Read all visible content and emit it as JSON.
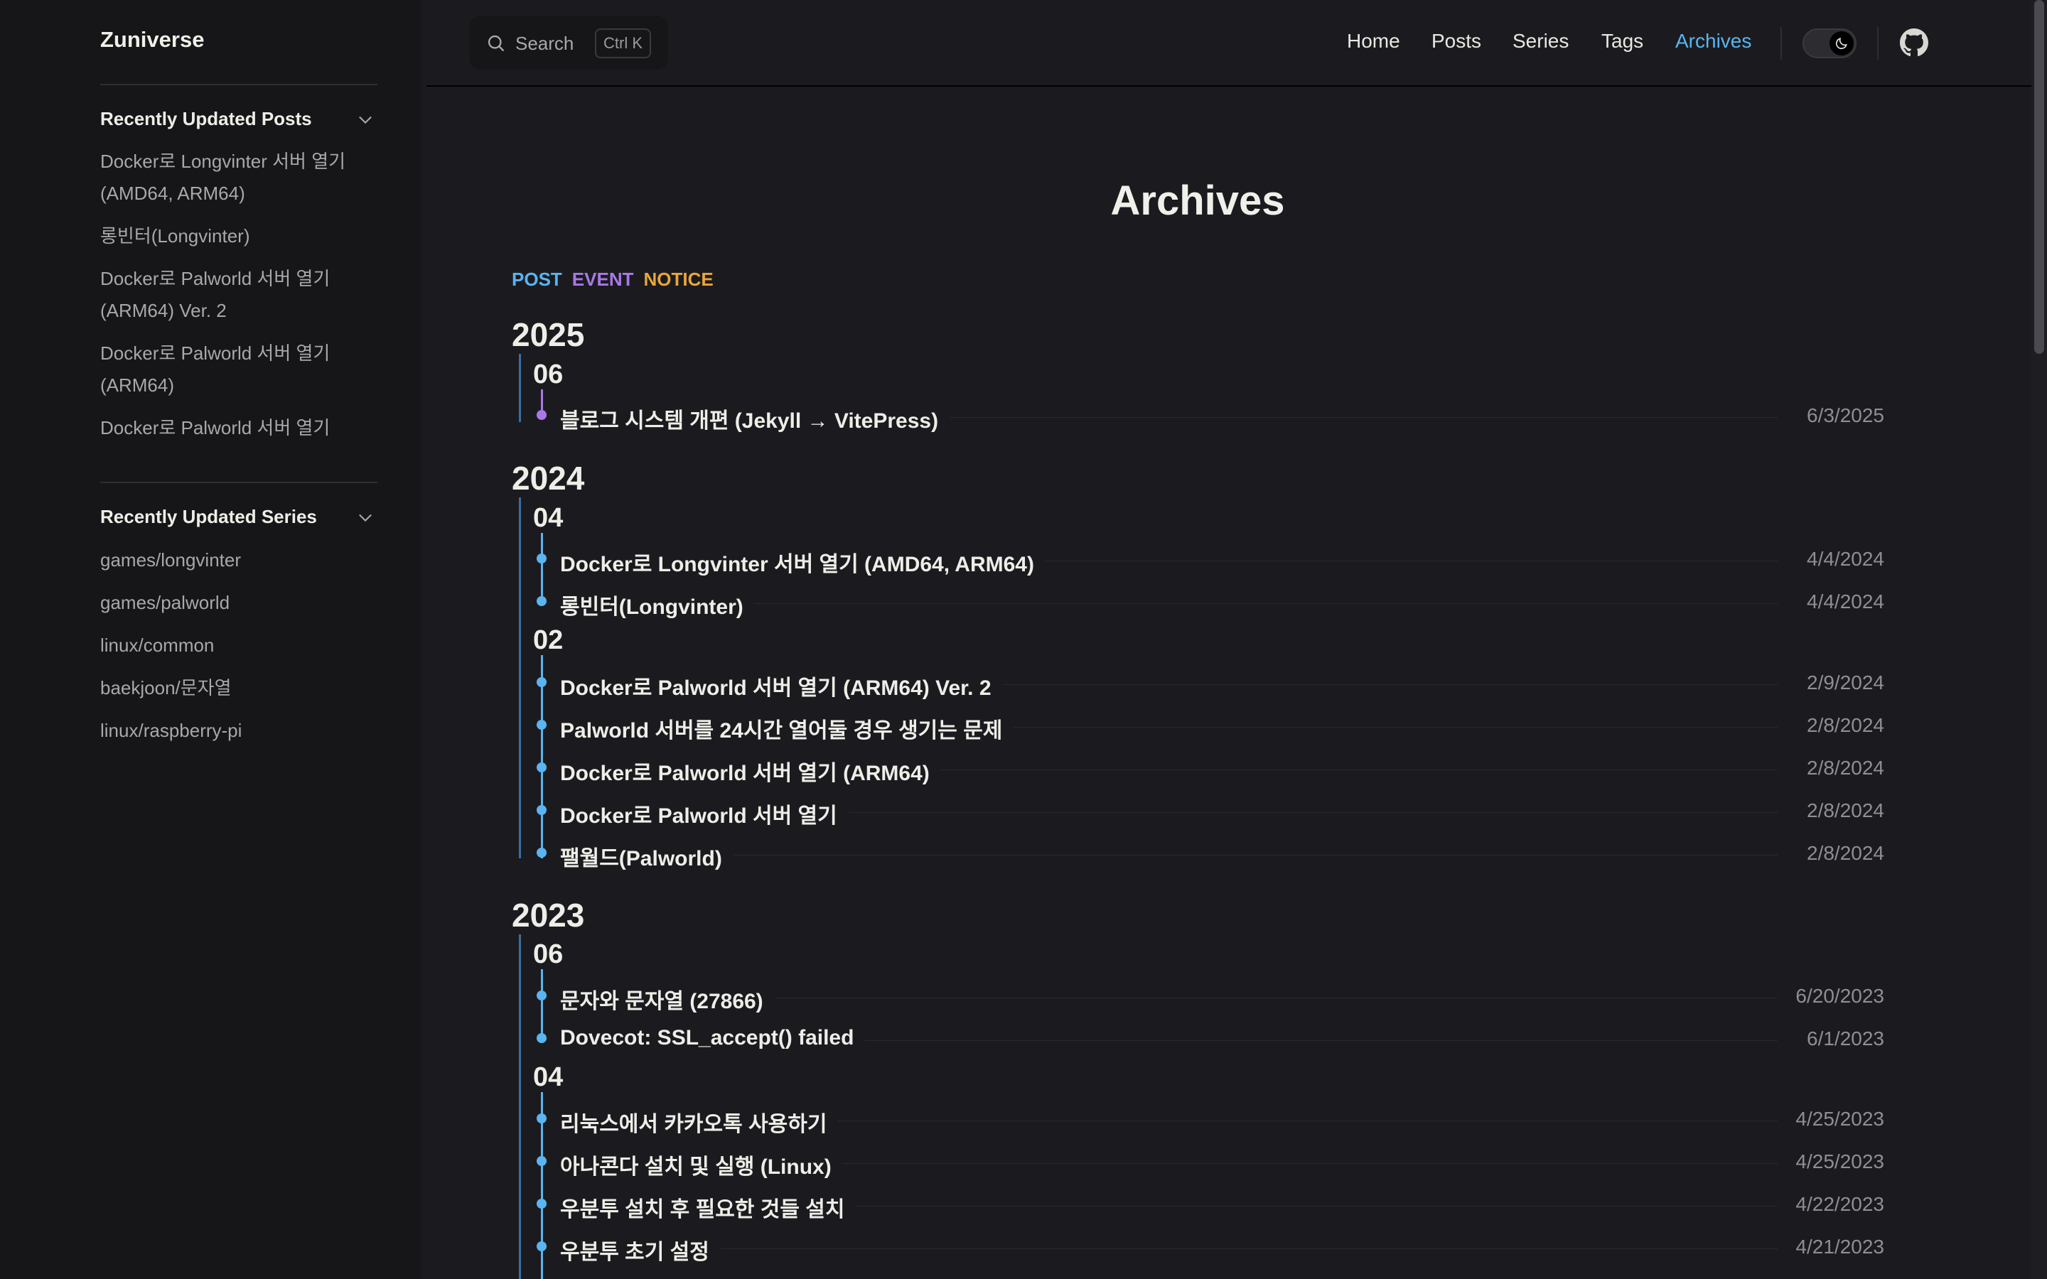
{
  "site": {
    "brand": "Zuniverse"
  },
  "search": {
    "label": "Search",
    "shortcut": "Ctrl K"
  },
  "nav": {
    "home": "Home",
    "posts": "Posts",
    "series": "Series",
    "tags": "Tags",
    "archives": "Archives"
  },
  "sidebar": {
    "posts_title": "Recently Updated Posts",
    "posts": [
      "Docker로 Longvinter 서버 열기 (AMD64, ARM64)",
      "롱빈터(Longvinter)",
      "Docker로 Palworld 서버 열기 (ARM64) Ver. 2",
      "Docker로 Palworld 서버 열기 (ARM64)",
      "Docker로 Palworld 서버 열기"
    ],
    "series_title": "Recently Updated Series",
    "series": [
      "games/longvinter",
      "games/palworld",
      "linux/common",
      "baekjoon/문자열",
      "linux/raspberry-pi"
    ]
  },
  "page": {
    "title": "Archives",
    "legend": {
      "post": "POST",
      "event": "EVENT",
      "notice": "NOTICE"
    }
  },
  "colors": {
    "post": "#5ab4f0",
    "event": "#a879e6",
    "notice": "#e9a53b"
  },
  "archives": [
    {
      "year": "2025",
      "months": [
        {
          "month": "06",
          "posts": [
            {
              "title": "블로그 시스템 개편 (Jekyll → VitePress)",
              "date": "6/3/2025",
              "type": "event"
            }
          ]
        }
      ]
    },
    {
      "year": "2024",
      "months": [
        {
          "month": "04",
          "posts": [
            {
              "title": "Docker로 Longvinter 서버 열기 (AMD64, ARM64)",
              "date": "4/4/2024",
              "type": "post"
            },
            {
              "title": "롱빈터(Longvinter)",
              "date": "4/4/2024",
              "type": "post"
            }
          ]
        },
        {
          "month": "02",
          "posts": [
            {
              "title": "Docker로 Palworld 서버 열기 (ARM64) Ver. 2",
              "date": "2/9/2024",
              "type": "post"
            },
            {
              "title": "Palworld 서버를 24시간 열어둘 경우 생기는 문제",
              "date": "2/8/2024",
              "type": "post"
            },
            {
              "title": "Docker로 Palworld 서버 열기 (ARM64)",
              "date": "2/8/2024",
              "type": "post"
            },
            {
              "title": "Docker로 Palworld 서버 열기",
              "date": "2/8/2024",
              "type": "post"
            },
            {
              "title": "팰월드(Palworld)",
              "date": "2/8/2024",
              "type": "post"
            }
          ]
        }
      ]
    },
    {
      "year": "2023",
      "months": [
        {
          "month": "06",
          "posts": [
            {
              "title": "문자와 문자열 (27866)",
              "date": "6/20/2023",
              "type": "post"
            },
            {
              "title": "Dovecot: SSL_accept() failed",
              "date": "6/1/2023",
              "type": "post"
            }
          ]
        },
        {
          "month": "04",
          "posts": [
            {
              "title": "리눅스에서 카카오톡 사용하기",
              "date": "4/25/2023",
              "type": "post"
            },
            {
              "title": "아나콘다 설치 및 실행 (Linux)",
              "date": "4/25/2023",
              "type": "post"
            },
            {
              "title": "우분투 설치 후 필요한 것들 설치",
              "date": "4/22/2023",
              "type": "post"
            },
            {
              "title": "우분투 초기 설정",
              "date": "4/21/2023",
              "type": "post"
            }
          ]
        }
      ]
    }
  ]
}
